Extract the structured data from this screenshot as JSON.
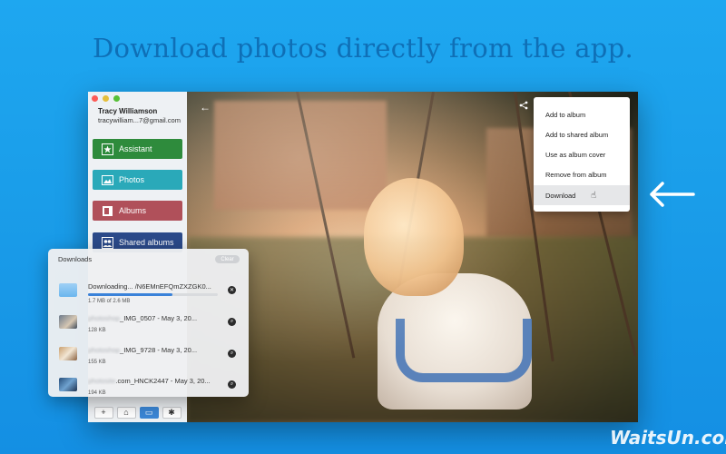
{
  "headline": "Download photos directly from the app.",
  "window": {
    "controls": [
      "close",
      "minimize",
      "zoom"
    ]
  },
  "account": {
    "name": "Tracy Williamson",
    "email": "tracywilliam...7@gmail.com"
  },
  "nav": [
    {
      "label": "Assistant",
      "icon": "star-icon",
      "color": "#2e8b3c"
    },
    {
      "label": "Photos",
      "icon": "photo-icon",
      "color": "#2aa9b9"
    },
    {
      "label": "Albums",
      "icon": "albums-icon",
      "color": "#b0505a"
    },
    {
      "label": "Shared albums",
      "icon": "shared-icon",
      "color": "#2b4a8a"
    }
  ],
  "bottombar": [
    {
      "icon": "plus-icon",
      "glyph": "+"
    },
    {
      "icon": "home-icon",
      "glyph": "⌂"
    },
    {
      "icon": "folder-icon",
      "glyph": "▭",
      "active": true
    },
    {
      "icon": "gear-icon",
      "glyph": "✱"
    }
  ],
  "menu": {
    "items": [
      "Add to album",
      "Add to shared album",
      "Use as album cover",
      "Remove from album",
      "Download"
    ],
    "hover_index": 4
  },
  "downloads": {
    "title": "Downloads",
    "clear_label": "Clear",
    "items": [
      {
        "prefix": "Downloading... ",
        "name": "/N6EMnEFQmZXZGK0...",
        "size": "1.7 MB of 2.6 MB",
        "progress": 0.65,
        "action": "cancel"
      },
      {
        "prefix": "photoshop",
        "name": "_IMG_0507 - May 3, 20...",
        "size": "128 KB",
        "action": "reveal"
      },
      {
        "prefix": "photoshop",
        "name": "_IMG_9728 - May 3, 20...",
        "size": "155 KB",
        "action": "reveal"
      },
      {
        "prefix": "photosite",
        "name": ".com_HNCK2447 - May 3, 20...",
        "size": "194 KB",
        "action": "reveal"
      }
    ]
  },
  "watermark": "WaitsUn.com",
  "colors": {
    "background": "#1a9de9",
    "accent": "#3a82d9"
  }
}
